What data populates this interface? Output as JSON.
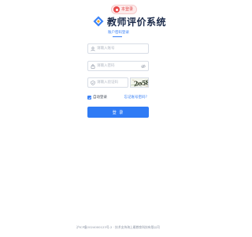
{
  "badge": {
    "icon": "pin-icon",
    "text": "本登录"
  },
  "brand": {
    "logo": "diamond-logo-icon",
    "title": "教师评价系统"
  },
  "tabs": [
    {
      "label": "账户密码登录",
      "active": true
    }
  ],
  "form": {
    "username": {
      "placeholder": "请输入账号",
      "value": "",
      "icon": "user-icon"
    },
    "password": {
      "placeholder": "请输入密码",
      "value": "",
      "icon": "lock-icon",
      "toggle_icon": "eye-icon"
    },
    "captcha": {
      "placeholder": "请输入验证码",
      "value": "",
      "icon": "shield-icon",
      "image_text": "2o58"
    },
    "remember": {
      "label": "自动登录",
      "checked": true
    },
    "forgot_label": "忘记账号密码？",
    "submit_label": "登 录"
  },
  "footer": {
    "text": "沪ICP备2024000123号-2 · 技术支持海上雁教育科技有限公司"
  },
  "colors": {
    "accent": "#2f7bf5",
    "title": "#1b2a4a",
    "badge_bg": "#fdecec",
    "badge_fg": "#e14444"
  }
}
